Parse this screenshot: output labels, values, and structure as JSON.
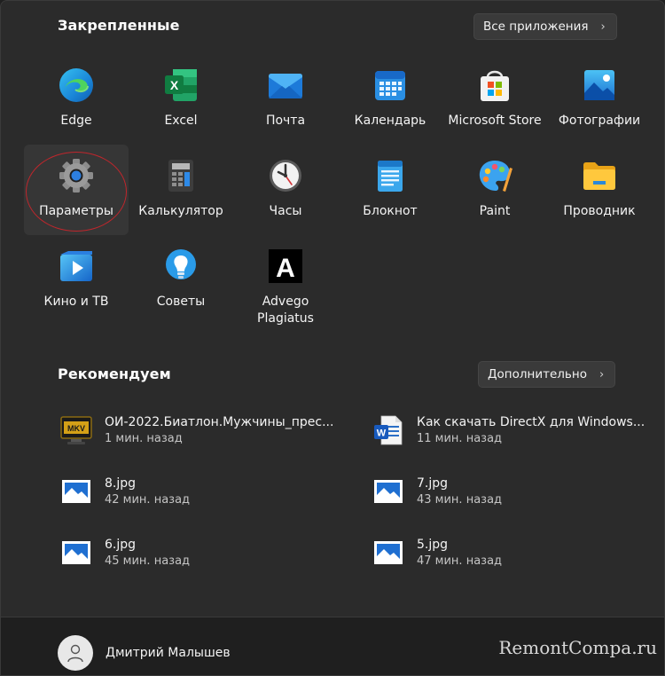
{
  "pinned": {
    "title": "Закрепленные",
    "all_apps_label": "Все приложения",
    "apps": [
      {
        "label": "Edge",
        "icon": "edge-icon"
      },
      {
        "label": "Excel",
        "icon": "excel-icon"
      },
      {
        "label": "Почта",
        "icon": "mail-icon"
      },
      {
        "label": "Календарь",
        "icon": "calendar-icon"
      },
      {
        "label": "Microsoft Store",
        "icon": "store-icon"
      },
      {
        "label": "Фотографии",
        "icon": "photos-icon"
      },
      {
        "label": "Параметры",
        "icon": "settings-gear-icon"
      },
      {
        "label": "Калькулятор",
        "icon": "calculator-icon"
      },
      {
        "label": "Часы",
        "icon": "clock-icon"
      },
      {
        "label": "Блокнот",
        "icon": "notepad-icon"
      },
      {
        "label": "Paint",
        "icon": "paint-palette-icon"
      },
      {
        "label": "Проводник",
        "icon": "folder-icon"
      },
      {
        "label": "Кино и ТВ",
        "icon": "movies-tv-icon"
      },
      {
        "label": "Советы",
        "icon": "tips-bulb-icon"
      },
      {
        "label": "Advego",
        "label2": "Plagiatus",
        "icon": "advego-icon"
      }
    ]
  },
  "recommended": {
    "title": "Рекомендуем",
    "more_label": "Дополнительно",
    "items": [
      {
        "name": "ОИ-2022.Биатлон.Мужчины_прес...",
        "time": "1 мин. назад",
        "icon": "mkv-video-icon"
      },
      {
        "name": "Как скачать DirectX для Windows...",
        "time": "11 мин. назад",
        "icon": "word-document-icon"
      },
      {
        "name": "8.jpg",
        "time": "42 мин. назад",
        "icon": "image-file-icon"
      },
      {
        "name": "7.jpg",
        "time": "43 мин. назад",
        "icon": "image-file-icon"
      },
      {
        "name": "6.jpg",
        "time": "45 мин. назад",
        "icon": "image-file-icon"
      },
      {
        "name": "5.jpg",
        "time": "47 мин. назад",
        "icon": "image-file-icon"
      }
    ]
  },
  "user": {
    "name": "Дмитрий Малышев"
  },
  "watermark": "RemontCompa.ru",
  "colors": {
    "accent_ring": "#c0262c",
    "background": "#2b2b2b"
  }
}
